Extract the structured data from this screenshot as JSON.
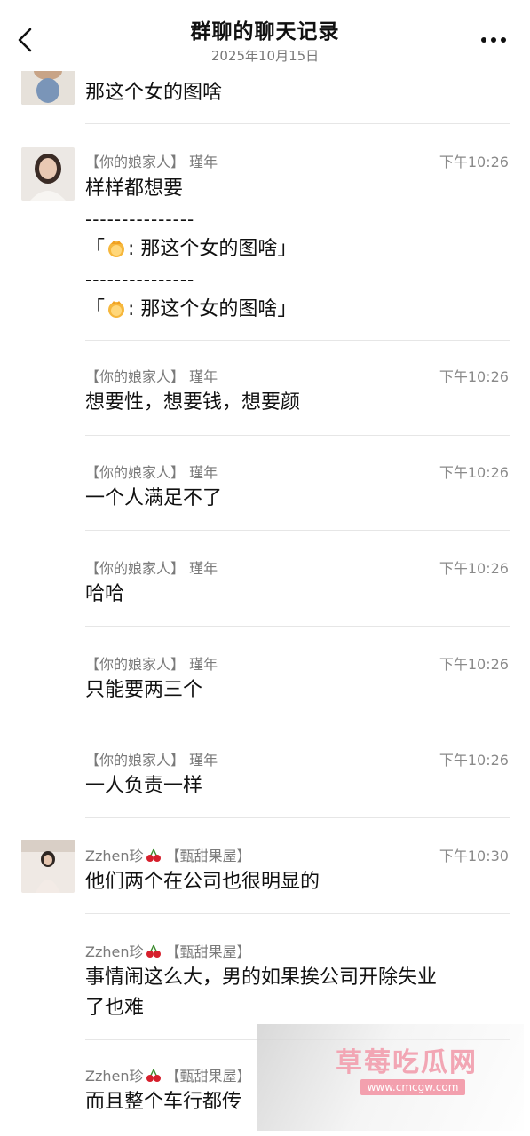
{
  "header": {
    "title": "群聊的聊天记录",
    "date": "2025年10月15日",
    "back_icon": "chevron-left-icon",
    "more_icon": "more-dots-icon"
  },
  "messages": [
    {
      "sender": "",
      "time": "",
      "lines": [
        "那这个女的图啥"
      ]
    },
    {
      "sender": "【你的娘家人】  瑾年",
      "time": "下午10:26",
      "lines": [
        "样样都想要"
      ],
      "quote_divider": "---------------",
      "quote_text": ": 那这个女的图啥",
      "quote_open": "「",
      "quote_close": "」",
      "quote_emoji": "woman-emoji-icon"
    },
    {
      "sender": "【你的娘家人】  瑾年",
      "time": "下午10:26",
      "lines": [
        "想要性，想要钱，想要颜"
      ]
    },
    {
      "sender": "【你的娘家人】  瑾年",
      "time": "下午10:26",
      "lines": [
        "一个人满足不了"
      ]
    },
    {
      "sender": "【你的娘家人】  瑾年",
      "time": "下午10:26",
      "lines": [
        "哈哈"
      ]
    },
    {
      "sender": "【你的娘家人】  瑾年",
      "time": "下午10:26",
      "lines": [
        "只能要两三个"
      ]
    },
    {
      "sender": "【你的娘家人】  瑾年",
      "time": "下午10:26",
      "lines": [
        "一人负责一样"
      ]
    },
    {
      "sender_name": "Zzhen珍",
      "sender_tag": "【甄甜果屋】",
      "time": "下午10:30",
      "lines": [
        "他们两个在公司也很明显的"
      ]
    },
    {
      "sender_name": "Zzhen珍",
      "sender_tag": "【甄甜果屋】",
      "time": "",
      "lines": [
        "事情闹这么大，男的如果挨公司开除失业",
        "了也难"
      ]
    },
    {
      "sender_name": "Zzhen珍",
      "sender_tag": "【甄甜果屋】",
      "time": "",
      "lines": [
        "而且整个车行都传"
      ]
    }
  ],
  "watermark": {
    "title": "草莓吃瓜网",
    "url": "www.cmcgw.com"
  },
  "colors": {
    "text": "#111111",
    "meta": "#7a7a7a",
    "divider": "#e6e6e6",
    "watermark": "#f2a6b4"
  }
}
